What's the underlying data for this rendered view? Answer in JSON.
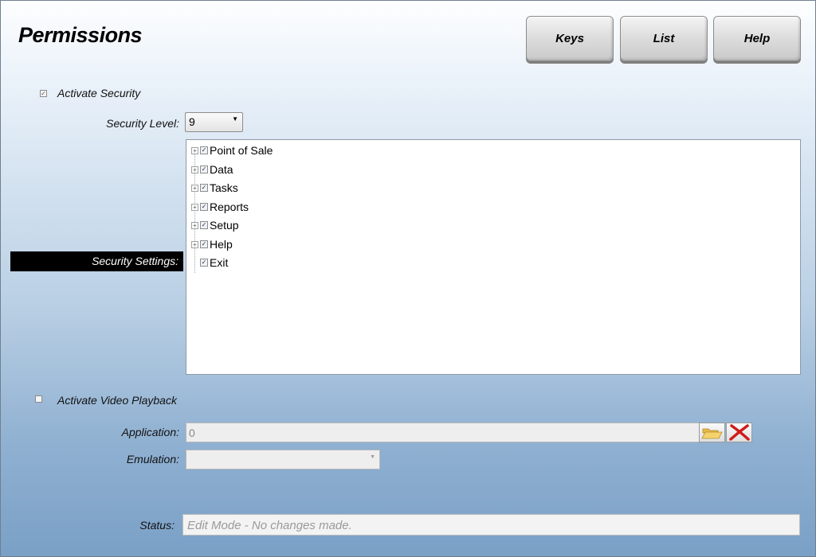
{
  "window": {
    "title": "Permissions"
  },
  "toolbar": {
    "keys_label": "Keys",
    "list_label": "List",
    "help_label": "Help"
  },
  "security": {
    "activate_label": "Activate Security",
    "activate_checked": true,
    "level_label": "Security Level:",
    "level_value": "9",
    "settings_label": "Security Settings:",
    "tree_items": [
      {
        "label": "Point of Sale",
        "checked": true,
        "expandable": true
      },
      {
        "label": "Data",
        "checked": true,
        "expandable": true
      },
      {
        "label": "Tasks",
        "checked": true,
        "expandable": true
      },
      {
        "label": "Reports",
        "checked": true,
        "expandable": true
      },
      {
        "label": "Setup",
        "checked": true,
        "expandable": true
      },
      {
        "label": "Help",
        "checked": true,
        "expandable": true
      },
      {
        "label": "Exit",
        "checked": true,
        "expandable": false
      }
    ]
  },
  "video": {
    "activate_label": "Activate Video Playback",
    "activate_checked": false,
    "application_label": "Application:",
    "application_value": "0",
    "emulation_label": "Emulation:",
    "emulation_value": ""
  },
  "status": {
    "label": "Status:",
    "value": "Edit Mode - No changes made."
  },
  "icons": {
    "browse": "folder-open-icon",
    "clear": "red-x-icon"
  }
}
